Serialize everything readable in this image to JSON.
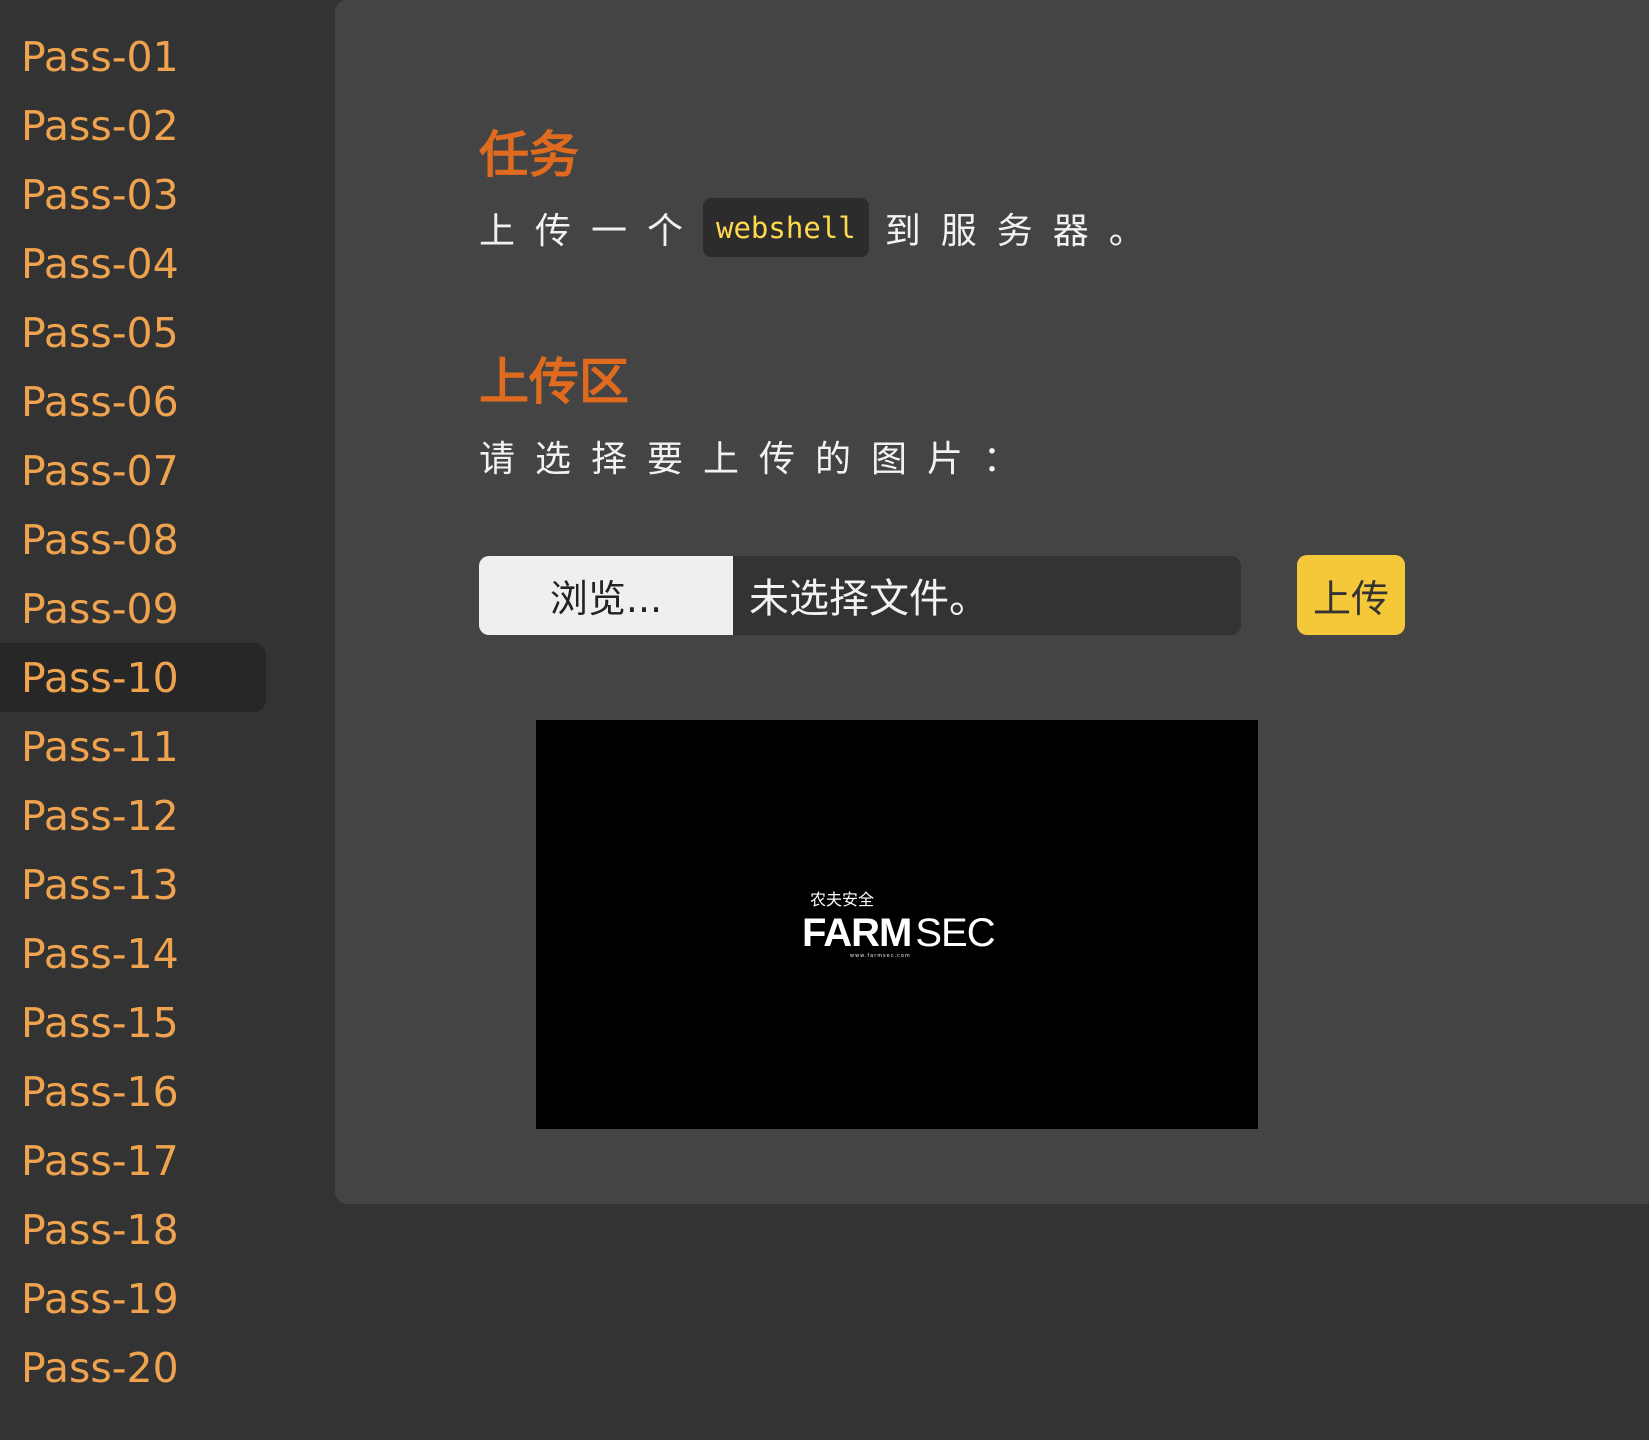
{
  "sidebar": {
    "items": [
      {
        "label": "Pass-01"
      },
      {
        "label": "Pass-02"
      },
      {
        "label": "Pass-03"
      },
      {
        "label": "Pass-04"
      },
      {
        "label": "Pass-05"
      },
      {
        "label": "Pass-06"
      },
      {
        "label": "Pass-07"
      },
      {
        "label": "Pass-08"
      },
      {
        "label": "Pass-09"
      },
      {
        "label": "Pass-10",
        "active": true
      },
      {
        "label": "Pass-11"
      },
      {
        "label": "Pass-12"
      },
      {
        "label": "Pass-13"
      },
      {
        "label": "Pass-14"
      },
      {
        "label": "Pass-15"
      },
      {
        "label": "Pass-16"
      },
      {
        "label": "Pass-17"
      },
      {
        "label": "Pass-18"
      },
      {
        "label": "Pass-19"
      },
      {
        "label": "Pass-20"
      }
    ],
    "active_item": "Pass-10"
  },
  "main": {
    "task_title": "任务",
    "task_prefix": "上传一个",
    "task_code": "webshell",
    "task_suffix": "到服务器。",
    "upload_title": "上传区",
    "choose_label": "请选择要上传的图片：",
    "browse_label": "浏览...",
    "file_status": "未选择文件。",
    "upload_label": "上传",
    "preview_logo": {
      "cn_text": "农夫安全",
      "en_bold": "FARM",
      "en_light": "SEC",
      "small_text": "www.farmsec.com"
    }
  },
  "colors": {
    "background": "#333333",
    "panel": "#444444",
    "sidebar_text": "#f0a34e",
    "heading": "#e06b1f",
    "active_nav": "#272727",
    "code_text": "#ffd94d",
    "upload_button": "#f4c838",
    "preview_background": "#000000"
  }
}
